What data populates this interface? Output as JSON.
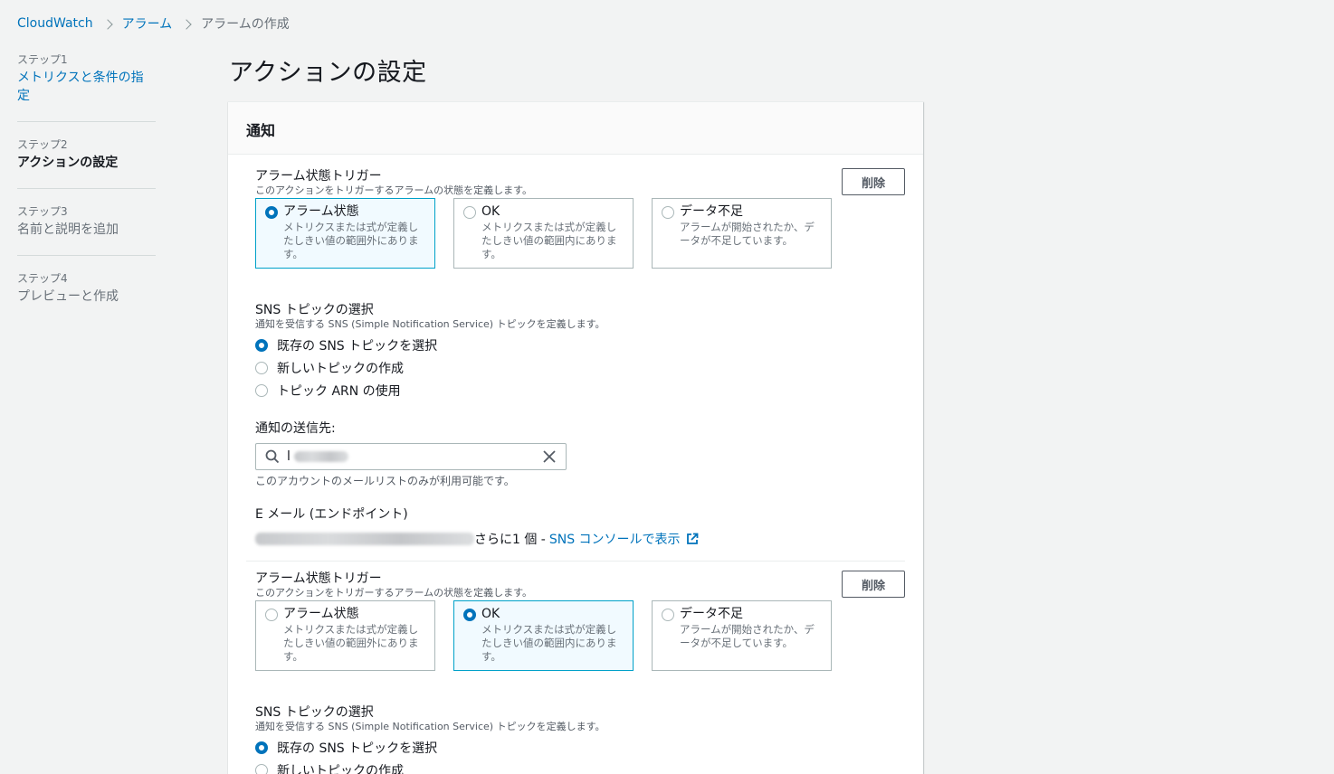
{
  "breadcrumb": {
    "items": [
      "CloudWatch",
      "アラーム"
    ],
    "current": "アラームの作成"
  },
  "steps": [
    {
      "num": "ステップ1",
      "title": "メトリクスと条件の指定"
    },
    {
      "num": "ステップ2",
      "title": "アクションの設定"
    },
    {
      "num": "ステップ3",
      "title": "名前と説明を追加"
    },
    {
      "num": "ステップ4",
      "title": "プレビューと作成"
    }
  ],
  "page_title": "アクションの設定",
  "panel_title": "通知",
  "delete_label": "削除",
  "trigger": {
    "label": "アラーム状態トリガー",
    "desc": "このアクションをトリガーするアラームの状態を定義します。",
    "tiles": [
      {
        "title": "アラーム状態",
        "desc": "メトリクスまたは式が定義したしきい値の範囲外にあります。"
      },
      {
        "title": "OK",
        "desc": "メトリクスまたは式が定義したしきい値の範囲内にあります。"
      },
      {
        "title": "データ不足",
        "desc": "アラームが開始されたか、データが不足しています。"
      }
    ]
  },
  "sns": {
    "label": "SNS トピックの選択",
    "desc": "通知を受信する SNS (Simple Notification Service) トピックを定義します。",
    "options": [
      "既存の SNS トピックを選択",
      "新しいトピックの作成",
      "トピック ARN の使用"
    ]
  },
  "send_to": {
    "label": "通知の送信先:",
    "value": "l",
    "hint": "このアカウントのメールリストのみが利用可能です。"
  },
  "email": {
    "label": "E メール (エンドポイント)",
    "more": "さらに1 個 -",
    "link": "SNS コンソールで表示"
  },
  "actions": [
    {
      "selected_tile": 0
    },
    {
      "selected_tile": 1
    }
  ]
}
